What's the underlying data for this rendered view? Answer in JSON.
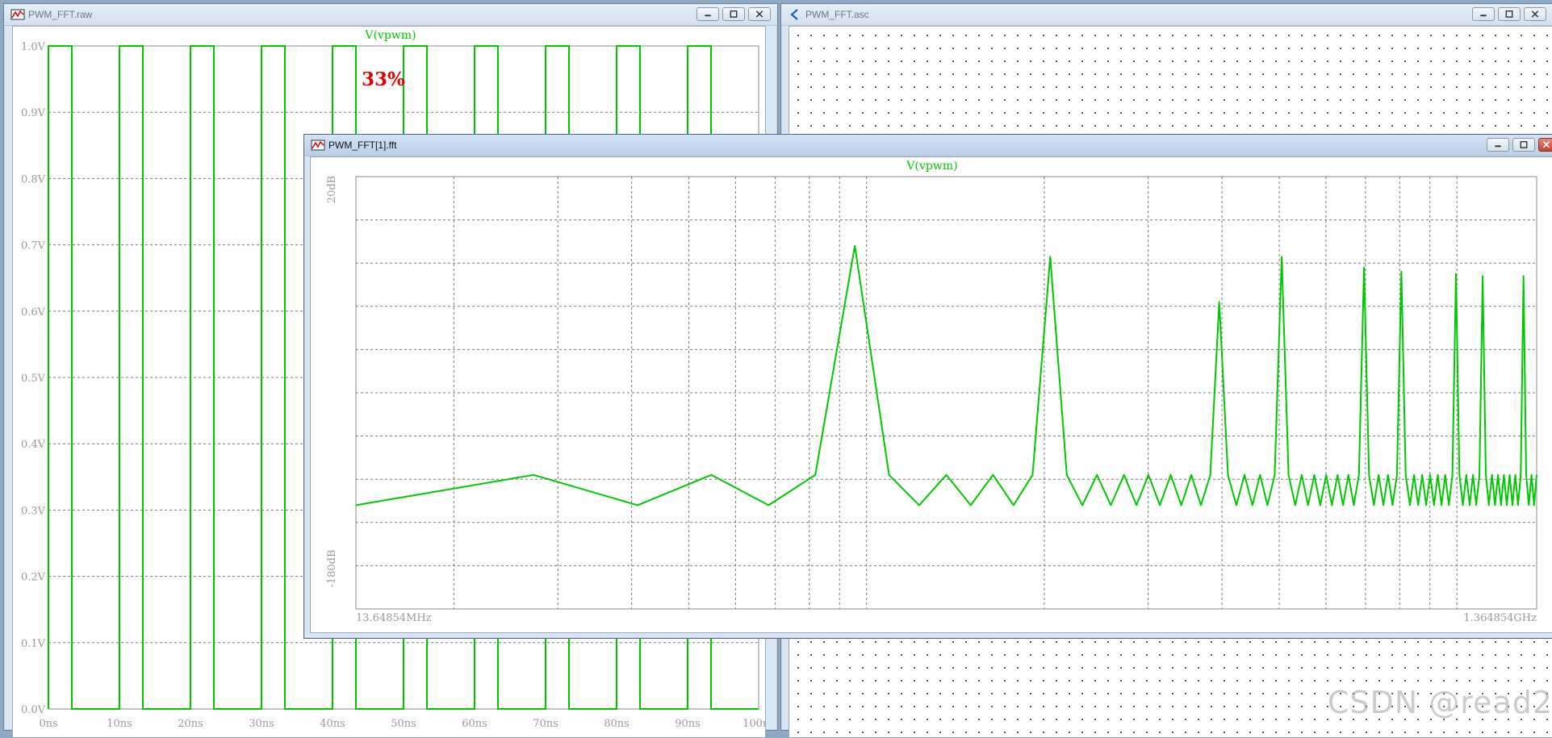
{
  "windows": {
    "raw": {
      "title": "PWM_FFT.raw",
      "trace_label": "V(vpwm)",
      "annotation": "33%",
      "y_ticks": [
        "0.0V",
        "0.1V",
        "0.2V",
        "0.3V",
        "0.4V",
        "0.5V",
        "0.6V",
        "0.7V",
        "0.8V",
        "0.9V",
        "1.0V"
      ],
      "x_ticks": [
        "0ns",
        "10ns",
        "20ns",
        "30ns",
        "40ns",
        "50ns",
        "60ns",
        "70ns",
        "80ns",
        "90ns",
        "100ns"
      ]
    },
    "asc": {
      "title": "PWM_FFT.asc"
    },
    "fft": {
      "title": "PWM_FFT[1].fft",
      "trace_label": "V(vpwm)",
      "y_top": "20dB",
      "y_bottom": "-180dB",
      "x_left": "13.64854MHz",
      "x_right": "1.364854GHz"
    }
  },
  "watermark": "CSDN @read2",
  "colors": {
    "trace": "#00c800",
    "annotation": "#e00000",
    "grid": "#707070"
  },
  "chart_data": [
    {
      "type": "line",
      "title": "V(vpwm)",
      "xlabel": "",
      "ylabel": "",
      "x_unit": "ns",
      "xlim": [
        0,
        100
      ],
      "ylim": [
        0,
        1.0
      ],
      "grid": true,
      "series": [
        {
          "name": "V(vpwm)",
          "period_ns": 10,
          "duty_cycle": 0.33,
          "x": [
            0,
            0,
            3.3,
            3.3,
            10,
            10,
            13.3,
            13.3,
            20,
            20,
            23.3,
            23.3,
            30,
            30,
            33.3,
            33.3,
            40,
            40,
            43.3,
            43.3,
            50,
            50,
            53.3,
            53.3,
            60,
            60,
            63.3,
            63.3,
            70,
            70,
            73.3,
            73.3,
            80,
            80,
            83.3,
            83.3,
            90,
            90,
            93.3,
            93.3,
            100
          ],
          "y": [
            0,
            1,
            1,
            0,
            0,
            1,
            1,
            0,
            0,
            1,
            1,
            0,
            0,
            1,
            1,
            0,
            0,
            1,
            1,
            0,
            0,
            1,
            1,
            0,
            0,
            1,
            1,
            0,
            0,
            1,
            1,
            0,
            0,
            1,
            1,
            0,
            0,
            1,
            1,
            0,
            0
          ]
        }
      ]
    },
    {
      "type": "line",
      "title": "V(vpwm)",
      "x_scale": "log",
      "x_unit": "MHz",
      "xlim": [
        13.64854,
        1364.854
      ],
      "ylim": [
        -180,
        20
      ],
      "y_unit": "dB",
      "grid": true,
      "series": [
        {
          "name": "V(vpwm)",
          "harmonic_magnitudes_db": [
            {
              "n": 1,
              "db": -12
            },
            {
              "n": 2,
              "db": -17
            },
            {
              "n": 4,
              "db": -38
            },
            {
              "n": 5,
              "db": -17
            },
            {
              "n": 7,
              "db": -22
            },
            {
              "n": 8,
              "db": -24
            },
            {
              "n": 10,
              "db": -25
            },
            {
              "n": 11,
              "db": -26
            },
            {
              "n": 13,
              "db": -26
            },
            {
              "n": 14,
              "db": -26
            },
            {
              "n": 16,
              "db": -27
            },
            {
              "n": 17,
              "db": -27
            },
            {
              "n": 19,
              "db": -27
            },
            {
              "n": 20,
              "db": -28
            },
            {
              "n": 22,
              "db": -28
            },
            {
              "n": 23,
              "db": -28
            },
            {
              "n": 25,
              "db": -28
            }
          ],
          "floor_db": -132,
          "bump_db": -118
        }
      ]
    }
  ]
}
